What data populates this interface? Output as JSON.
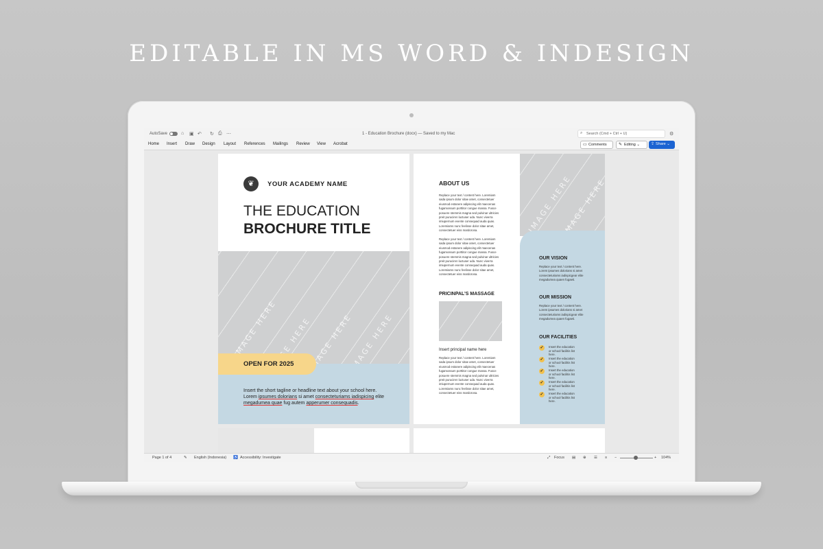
{
  "headline": "EDITABLE IN MS WORD & INDESIGN",
  "word": {
    "autosave_label": "AutoSave",
    "doc_title": "1 - Education Brochure (docx) — Saved to my Mac",
    "search_placeholder": "Search (Cmd + Ctrl + U)",
    "menu": [
      "Home",
      "Insert",
      "Draw",
      "Design",
      "Layout",
      "References",
      "Mailings",
      "Review",
      "View",
      "Acrobat"
    ],
    "comments_label": "Comments",
    "editing_label": "Editing",
    "share_label": "Share",
    "status": {
      "page": "Page 1 of 4",
      "language": "English (Indonesia)",
      "accessibility": "Accessibility: Investigate",
      "focus": "Focus",
      "zoom": "104%"
    }
  },
  "brochure": {
    "academy_name": "YOUR ACADEMY NAME",
    "title_line1": "THE EDUCATION",
    "title_line2": "BROCHURE TITLE",
    "image_placeholder": "IMAGE HERE",
    "open_label": "OPEN FOR 2025",
    "tagline_plain": "Insert the short tagline or headline text about your school here. Lorem ",
    "tagline_u1": "ipsumes dolorians",
    "tagline_mid": " si amet ",
    "tagline_u2": "consecteturiams iadispicing",
    "tagline_mid2": " elite ",
    "tagline_u3": "megadumea quae",
    "tagline_mid3": " fug autem ",
    "tagline_u4": "apperumer consequadis",
    "tagline_end": ".",
    "about_title": "ABOUT US",
    "about_p1": "Replace your text / content here. Loremiam sada ipsum dolor sitae amet, consectetuer eiusmod estanere adipiscing elit maecenas fugamossum porttitor congue massa. Fusce posuere stemmis magna sed pulvinar ultricies preit puruciren luctuser uda. Nunc viverra imiupernum evente consequad auda quas. Loremiams nunc feelisse dolor sitae amet, consectetuer eiss mardorosa.",
    "about_p2": "Replace your text / content here. Loremiam sada ipsum dolor sitae amet, consectetuer eiusmod estanere adipiscing elit maecenas fugamossum porttitor congue massa. Fusce posuere stemmis magna sed pulvinar ultricies preit puruciren luctuser uda. Nunc viverra imiupernum evente consequad auda quas. Loremiams nunc feelisse dolor sitae amet, consectetuer eiss mardorosa.",
    "principal_title": "PRICINPAL’S MASSAGE",
    "principal_name": "Insert principal name here",
    "principal_p": "Replace your text / content here. Loremiam sada ipsum dolor sitae amet, consectetuer eiusmod estanere adipiscing elit maecenas fugamossum porttitor congue massa. Fusce posuere stemmis magna sed pulvinar ultricies preit puruciren luctuser uda. Nunc viverra imiupernum evente consequad auda quas. Loremiams nunc feelisse dolor sitae amet, consectetuer eiss mardorosa.",
    "vision_title": "OUR VISION",
    "vision_text": "Replace your text / content here. Lorem ipsumes dolorians si amet consecteturiams iadispicgear elite megadumea quaen fugaeti.",
    "mission_title": "OUR MISSION",
    "mission_text": "Replace your text / content here. Lorem ipsumes dolorians si amet consecteturiams iadispicgear elite megadumea quaen fugaeti.",
    "facilities_title": "OUR FACILITIES",
    "facilities": [
      "Insert the education or school facilitis list here.",
      "Insert the education or school facilitis list here.",
      "Insert the education or school facilitis list here.",
      "Insert the education or school facilitis list here.",
      "Insert the education or school facilitis list here."
    ]
  },
  "colors": {
    "accent_blue": "#c4d8e3",
    "accent_yellow": "#f7d68a",
    "share_blue": "#1c64d2"
  }
}
